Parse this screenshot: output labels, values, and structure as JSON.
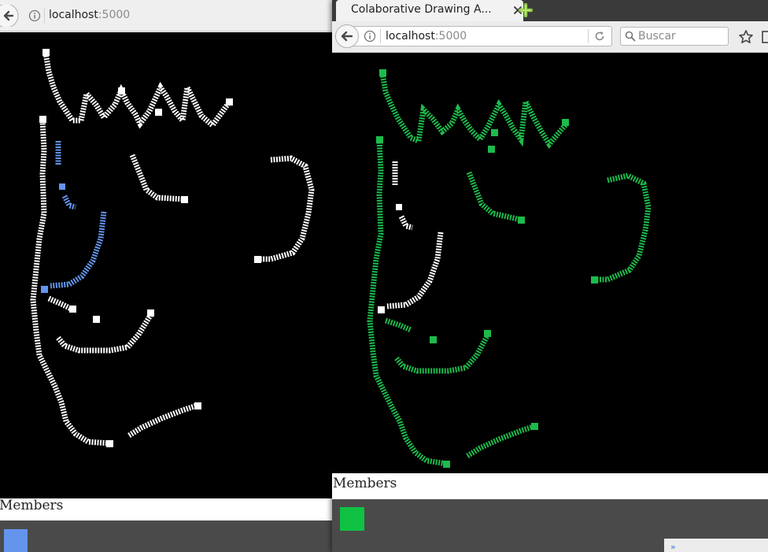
{
  "left_window": {
    "url_host": "localhost",
    "url_port": ":5000",
    "members_label": "Members",
    "member_colors": [
      "#6495ed"
    ]
  },
  "right_window": {
    "tab_title": "Colaborative Drawing A...",
    "url_host": "localhost",
    "url_port": ":5000",
    "search_placeholder": "Buscar",
    "members_label": "Members",
    "member_colors": [
      "#0fc244"
    ]
  },
  "colors": {
    "canvas": "#000000",
    "stroke_white": "#ffffff",
    "stroke_blue": "#6495ed",
    "stroke_green": "#1dbb4c",
    "members_bar": "#4a4a4a"
  },
  "icons": [
    "back-arrow-icon",
    "info-icon",
    "close-icon",
    "new-tab-icon",
    "reload-icon",
    "search-icon",
    "bookmark-star-icon",
    "library-icon"
  ]
}
